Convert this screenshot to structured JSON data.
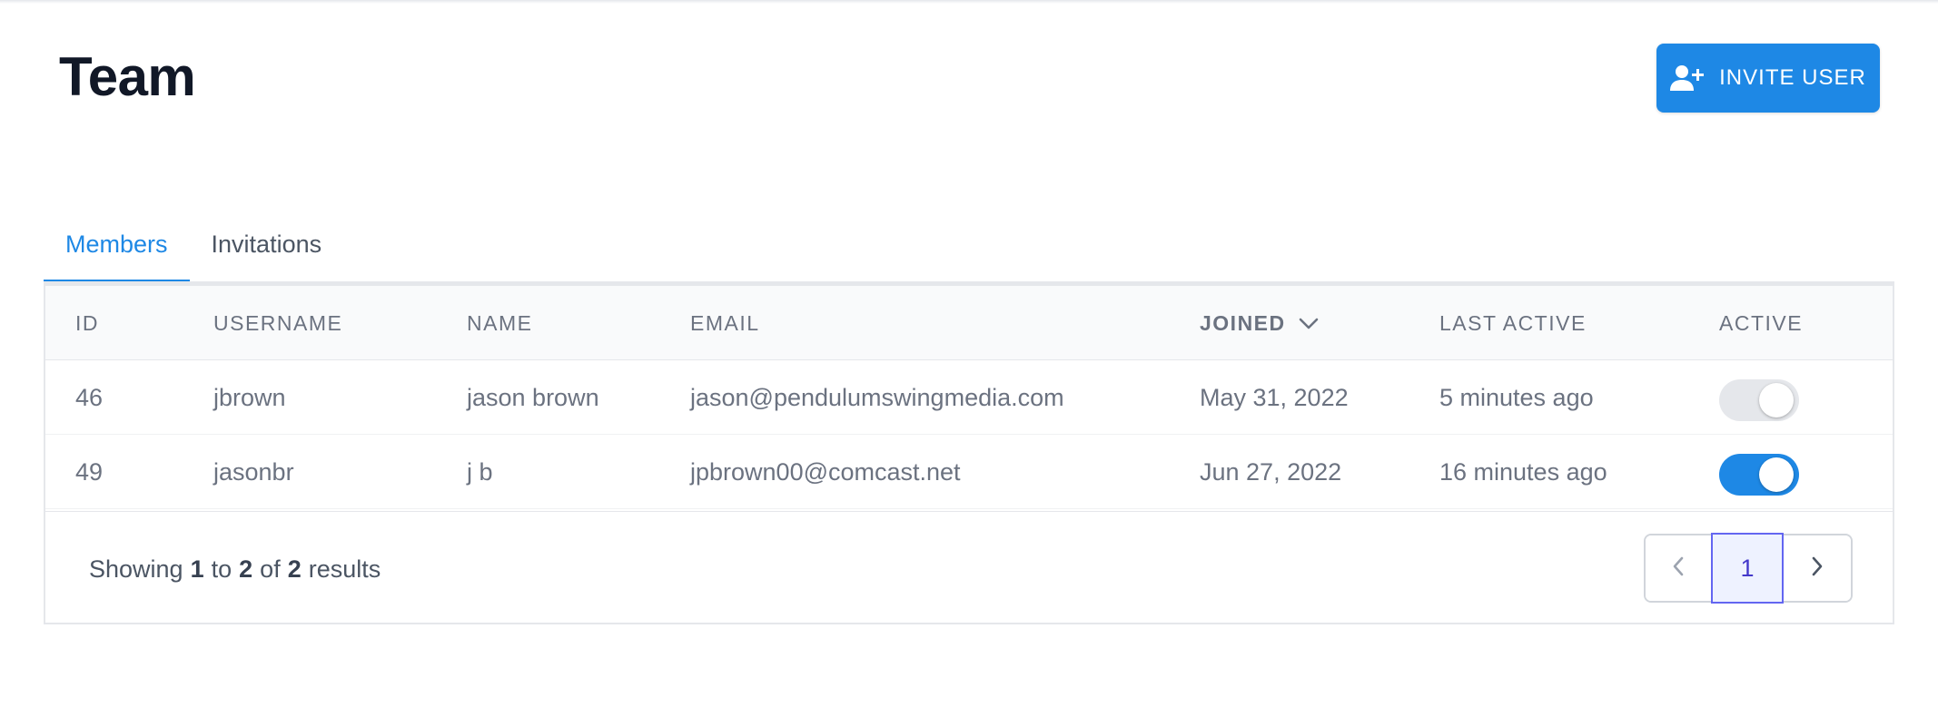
{
  "header": {
    "title": "Team",
    "invite_label": "INVITE USER"
  },
  "tabs": [
    {
      "label": "Members",
      "active": true
    },
    {
      "label": "Invitations",
      "active": false
    }
  ],
  "table": {
    "columns": {
      "id": "ID",
      "username": "USERNAME",
      "name": "NAME",
      "email": "EMAIL",
      "joined": "JOINED",
      "last_active": "LAST ACTIVE",
      "active": "ACTIVE"
    },
    "sorted_by": "joined",
    "rows": [
      {
        "id": "46",
        "username": "jbrown",
        "name": "jason brown",
        "email": "jason@pendulumswingmedia.com",
        "joined": "May 31, 2022",
        "last_active": "5 minutes ago",
        "active": false
      },
      {
        "id": "49",
        "username": "jasonbr",
        "name": "j b",
        "email": "jpbrown00@comcast.net",
        "joined": "Jun 27, 2022",
        "last_active": "16 minutes ago",
        "active": true
      }
    ]
  },
  "pagination": {
    "showing_prefix": "Showing",
    "from": "1",
    "to_word": "to",
    "to": "2",
    "of_word": "of",
    "total": "2",
    "suffix": "results",
    "current_page": "1"
  },
  "colors": {
    "accent": "#1e88e5",
    "toggle_off": "#e5e7eb",
    "page_active_bg": "#eef2ff",
    "page_active_border": "#6366f1"
  },
  "icons": {
    "invite": "user-plus-icon",
    "sort": "chevron-down-icon",
    "prev": "chevron-left-icon",
    "next": "chevron-right-icon"
  }
}
